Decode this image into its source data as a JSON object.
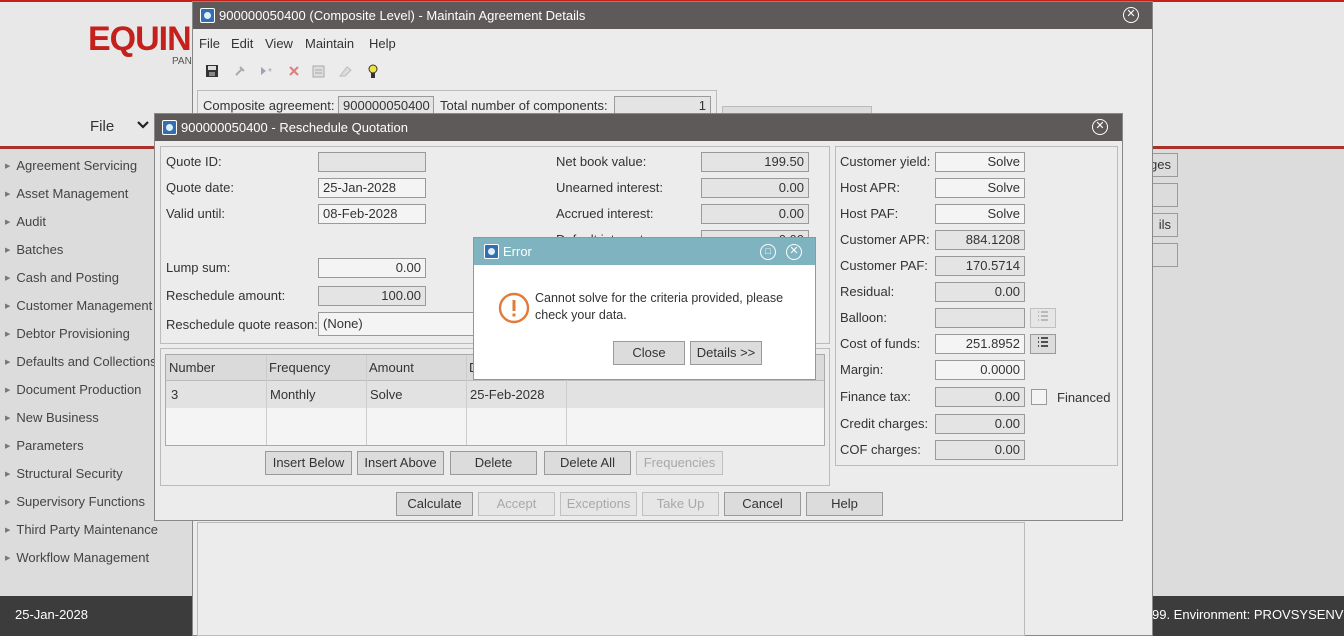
{
  "app": {
    "logo_text": "EQUIN",
    "logo_sub": "PAN",
    "file_menu": "File",
    "accent_red": "#c4201c"
  },
  "sidebar": {
    "items": [
      {
        "label": "Agreement Servicing"
      },
      {
        "label": "Asset Management"
      },
      {
        "label": "Audit"
      },
      {
        "label": "Batches"
      },
      {
        "label": "Cash and Posting"
      },
      {
        "label": "Customer Management"
      },
      {
        "label": "Debtor Provisioning"
      },
      {
        "label": "Defaults and Collections"
      },
      {
        "label": "Document Production"
      },
      {
        "label": "New Business"
      },
      {
        "label": "Parameters"
      },
      {
        "label": "Structural Security"
      },
      {
        "label": "Supervisory Functions"
      },
      {
        "label": "Third Party Maintenance"
      },
      {
        "label": "Workflow Management"
      }
    ]
  },
  "footer": {
    "date": "25-Jan-2028",
    "env": "99.  Environment: PROVSYSENV"
  },
  "right_panel": {
    "btn1": "ges",
    "btn3": "ils"
  },
  "maintain_window": {
    "title": "900000050400 (Composite Level) - Maintain Agreement Details",
    "menu": [
      "File",
      "Edit",
      "View",
      "Maintain",
      "Help"
    ],
    "composite_label": "Composite agreement:",
    "composite_value": "900000050400",
    "components_label": "Total number of components:",
    "components_value": "1"
  },
  "reschedule_window": {
    "title": "900000050400 - Reschedule Quotation",
    "left": {
      "quote_id_label": "Quote ID:",
      "quote_id_value": "",
      "quote_date_label": "Quote date:",
      "quote_date_value": "25-Jan-2028",
      "valid_until_label": "Valid until:",
      "valid_until_value": "08-Feb-2028",
      "lump_sum_label": "Lump sum:",
      "lump_sum_value": "0.00",
      "reschedule_amount_label": "Reschedule amount:",
      "reschedule_amount_value": "100.00",
      "reason_label": "Reschedule quote reason:",
      "reason_value": "(None)"
    },
    "middle": {
      "net_book_label": "Net book value:",
      "net_book_value": "199.50",
      "unearned_label": "Unearned interest:",
      "unearned_value": "0.00",
      "accrued_label": "Accrued interest:",
      "accrued_value": "0.00",
      "default_label": "Default interest:",
      "default_value": "0.00"
    },
    "grid": {
      "headers": [
        "Number",
        "Frequency",
        "Amount",
        "D"
      ],
      "rows": [
        [
          "3",
          "Monthly",
          "Solve",
          "25-Feb-2028"
        ]
      ]
    },
    "grid_buttons": [
      "Insert Below",
      "Insert Above",
      "Delete",
      "Delete All",
      "Frequencies"
    ],
    "bottom_buttons": [
      "Calculate",
      "Accept",
      "Exceptions",
      "Take Up",
      "Cancel",
      "Help"
    ],
    "right": {
      "customer_yield_label": "Customer yield:",
      "customer_yield_value": "Solve",
      "host_apr_label": "Host APR:",
      "host_apr_value": "Solve",
      "host_paf_label": "Host PAF:",
      "host_paf_value": "Solve",
      "customer_apr_label": "Customer APR:",
      "customer_apr_value": "884.1208",
      "customer_paf_label": "Customer PAF:",
      "customer_paf_value": "170.5714",
      "residual_label": "Residual:",
      "residual_value": "0.00",
      "balloon_label": "Balloon:",
      "balloon_value": "",
      "cost_of_funds_label": "Cost of funds:",
      "cost_of_funds_value": "251.8952",
      "margin_label": "Margin:",
      "margin_value": "0.0000",
      "finance_tax_label": "Finance tax:",
      "finance_tax_value": "0.00",
      "financed_label": "Financed",
      "credit_charges_label": "Credit charges:",
      "credit_charges_value": "0.00",
      "cof_charges_label": "COF charges:",
      "cof_charges_value": "0.00"
    }
  },
  "error_dialog": {
    "title": "Error",
    "message_line1": "Cannot solve for the criteria provided, please",
    "message_line2": "check your data.",
    "close_label": "Close",
    "details_label": "Details >>",
    "header_color": "#7fb3c0",
    "icon_color": "#e07b39"
  }
}
